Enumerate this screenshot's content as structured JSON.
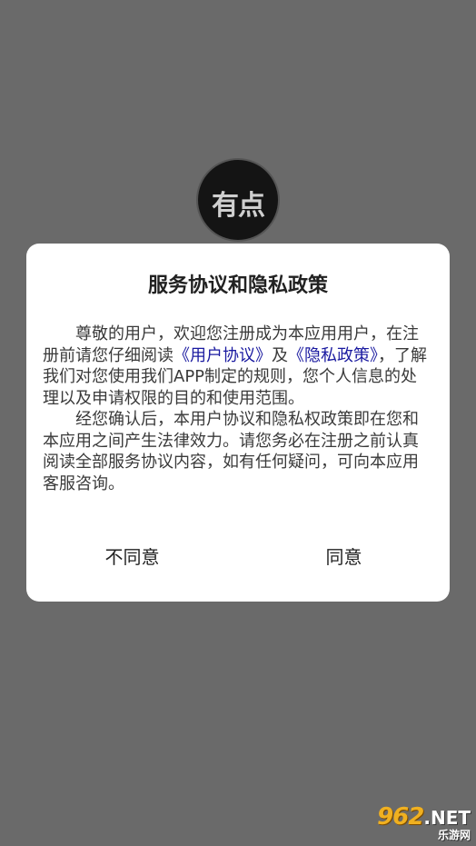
{
  "app_logo": {
    "icon": "app-logo-icon",
    "text": "有点"
  },
  "dialog": {
    "title": "服务协议和隐私政策",
    "paragraph1": {
      "part1": "尊敬的用户，欢迎您注册成为本应用用户，在注册前请您仔细阅读",
      "link_user_agreement": "《用户协议》",
      "part2": "及",
      "link_privacy_policy": "《隐私政策》",
      "part3": "，了解我们对您使用我们APP制定的规则，您个人信息的处理以及申请权限的目的和使用范围。"
    },
    "paragraph2": "经您确认后，本用户协议和隐私权政策即在您和本应用之间产生法律效力。请您务必在注册之前认真阅读全部服务协议内容，如有任何疑问，可向本应用客服咨询。",
    "buttons": {
      "disagree": "不同意",
      "agree": "同意"
    }
  },
  "watermark": {
    "number": "962",
    "domain": ".NET",
    "site": "乐游网"
  },
  "colors": {
    "overlay": "#6a6a6a",
    "dialog_bg": "#ffffff",
    "link": "#1a1aa0"
  }
}
